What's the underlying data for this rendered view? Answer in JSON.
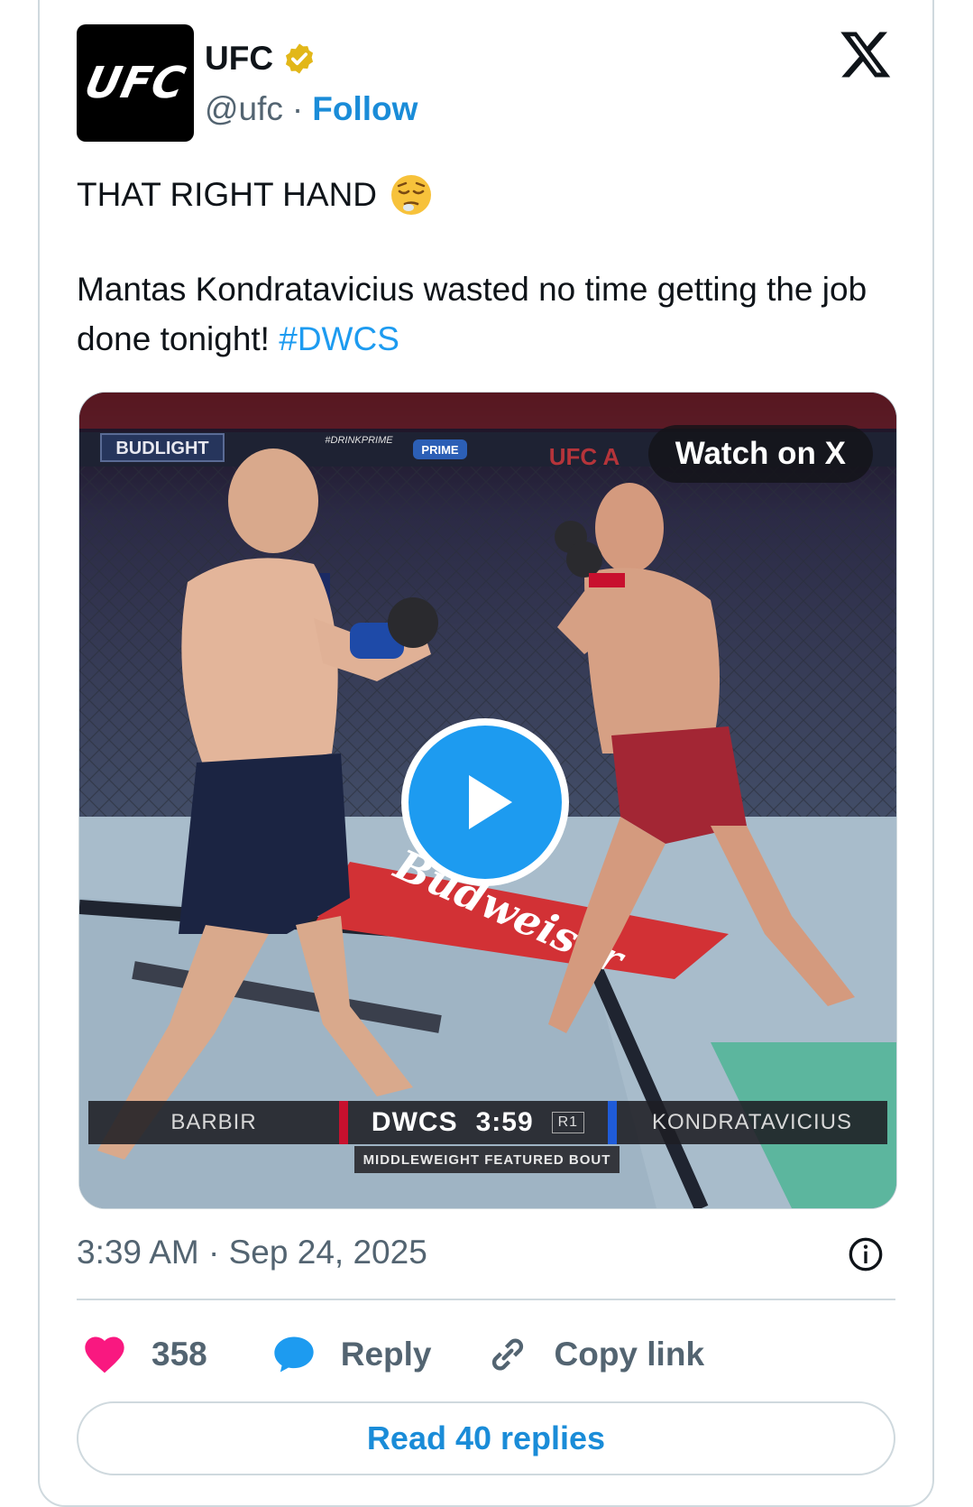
{
  "author": {
    "logo_text": "UFC",
    "name": "UFC",
    "handle": "@ufc",
    "separator": "·",
    "follow_label": "Follow"
  },
  "tweet": {
    "line1": "THAT RIGHT HAND",
    "line2": "Mantas Kondratavicius wasted no time getting the job done tonight!",
    "hashtag": "#DWCS",
    "timestamp": "3:39 AM · Sep 24, 2025"
  },
  "media": {
    "watch_label": "Watch on X",
    "banner_left": "BUDLIGHT",
    "banner_mid": "#DRINKPRIME",
    "banner_prime": "PRIME",
    "banner_right": "UFC A",
    "mat_text": "Budweiser",
    "scoreboard": {
      "fighter_left": "BARBIR",
      "event": "DWCS",
      "clock": "3:59",
      "round": "R1",
      "fighter_right": "KONDRATAVICIUS",
      "subtitle": "MIDDLEWEIGHT FEATURED BOUT"
    }
  },
  "actions": {
    "likes": "358",
    "reply_label": "Reply",
    "copy_label": "Copy link",
    "read_replies_label": "Read 40 replies"
  },
  "colors": {
    "accent": "#1d9bf0",
    "like": "#f91880",
    "muted": "#536471"
  }
}
